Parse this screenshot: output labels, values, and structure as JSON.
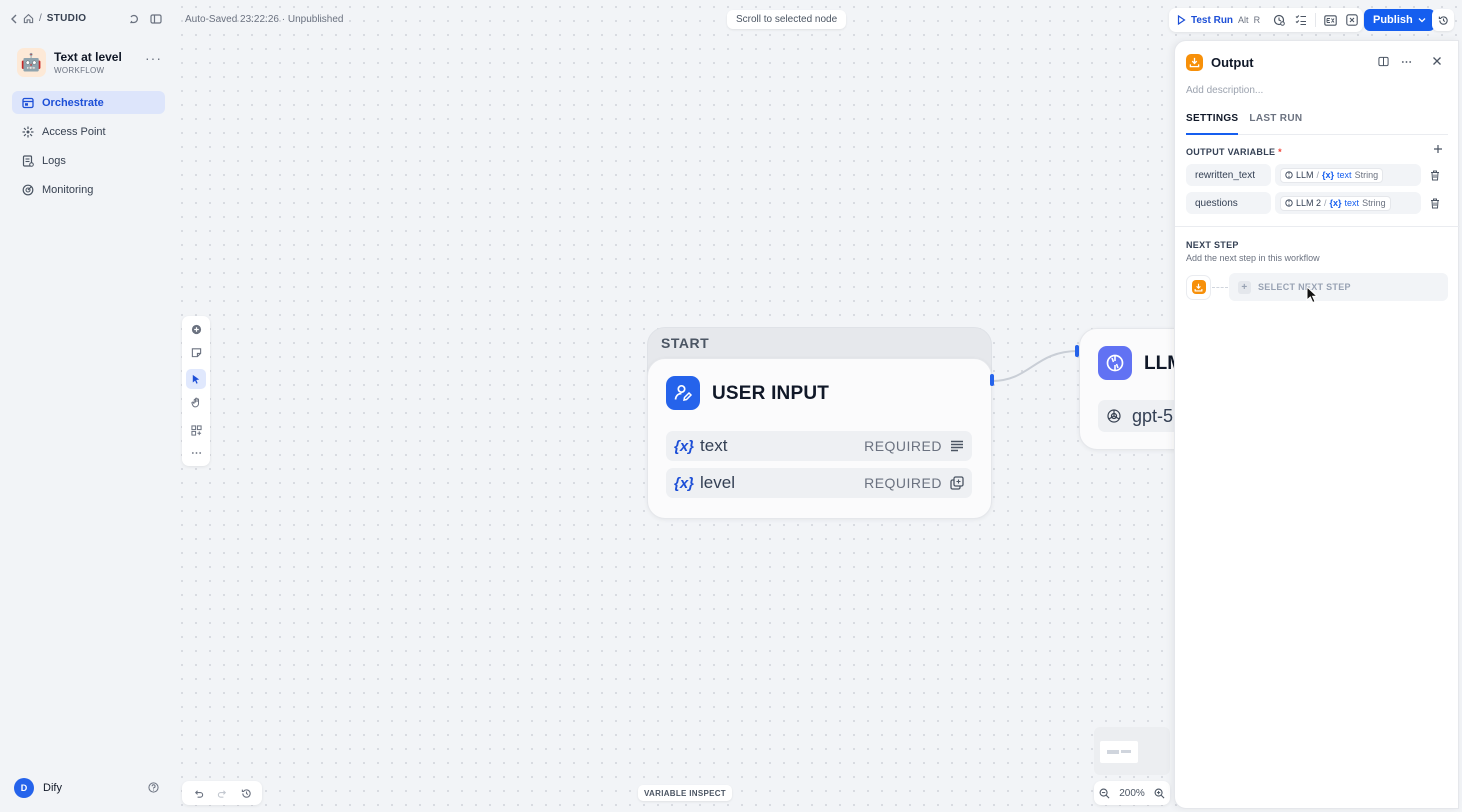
{
  "sidebar": {
    "breadcrumb": "STUDIO",
    "app": {
      "avatar": "🤖",
      "name": "Text at level",
      "kind": "WORKFLOW"
    },
    "nav": [
      {
        "label": "Orchestrate",
        "icon": "orchestrate-icon",
        "active": true
      },
      {
        "label": "Access Point",
        "icon": "access-point-icon",
        "active": false
      },
      {
        "label": "Logs",
        "icon": "logs-icon",
        "active": false
      },
      {
        "label": "Monitoring",
        "icon": "monitoring-icon",
        "active": false
      }
    ],
    "user": {
      "initial": "D",
      "name": "Dify"
    }
  },
  "canvas": {
    "autosave": "Auto-Saved 23:22:26 · Unpublished",
    "scroll_hint": "Scroll to selected node",
    "variable_inspect": "VARIABLE INSPECT",
    "zoom": "200%",
    "start_node": {
      "group_label": "START",
      "title": "USER INPUT",
      "variables": [
        {
          "prefix": "{x}",
          "name": "text",
          "required": "REQUIRED",
          "type_icon": "paragraph-icon"
        },
        {
          "prefix": "{x}",
          "name": "level",
          "required": "REQUIRED",
          "type_icon": "select-icon"
        }
      ]
    },
    "llm_node": {
      "title": "LLM",
      "model": "gpt-5"
    }
  },
  "topbar": {
    "test_run": "Test Run",
    "test_run_kbd_1": "Alt",
    "test_run_kbd_2": "R",
    "publish": "Publish"
  },
  "panel": {
    "title": "Output",
    "description_placeholder": "Add description...",
    "tabs": [
      "SETTINGS",
      "LAST RUN"
    ],
    "output_variable_title": "OUTPUT VARIABLE",
    "required_mark": "*",
    "outputs": [
      {
        "name": "rewritten_text",
        "node": "LLM",
        "var": "text",
        "type": "String"
      },
      {
        "name": "questions",
        "node": "LLM 2",
        "var": "text",
        "type": "String"
      }
    ],
    "next_step_title": "NEXT STEP",
    "next_step_subtitle": "Add the next step in this workflow",
    "select_next_step": "SELECT NEXT STEP"
  },
  "colors": {
    "accent": "#155eef",
    "user_input": "#2563eb",
    "llm": "#6172f3",
    "output": "#f79009"
  }
}
